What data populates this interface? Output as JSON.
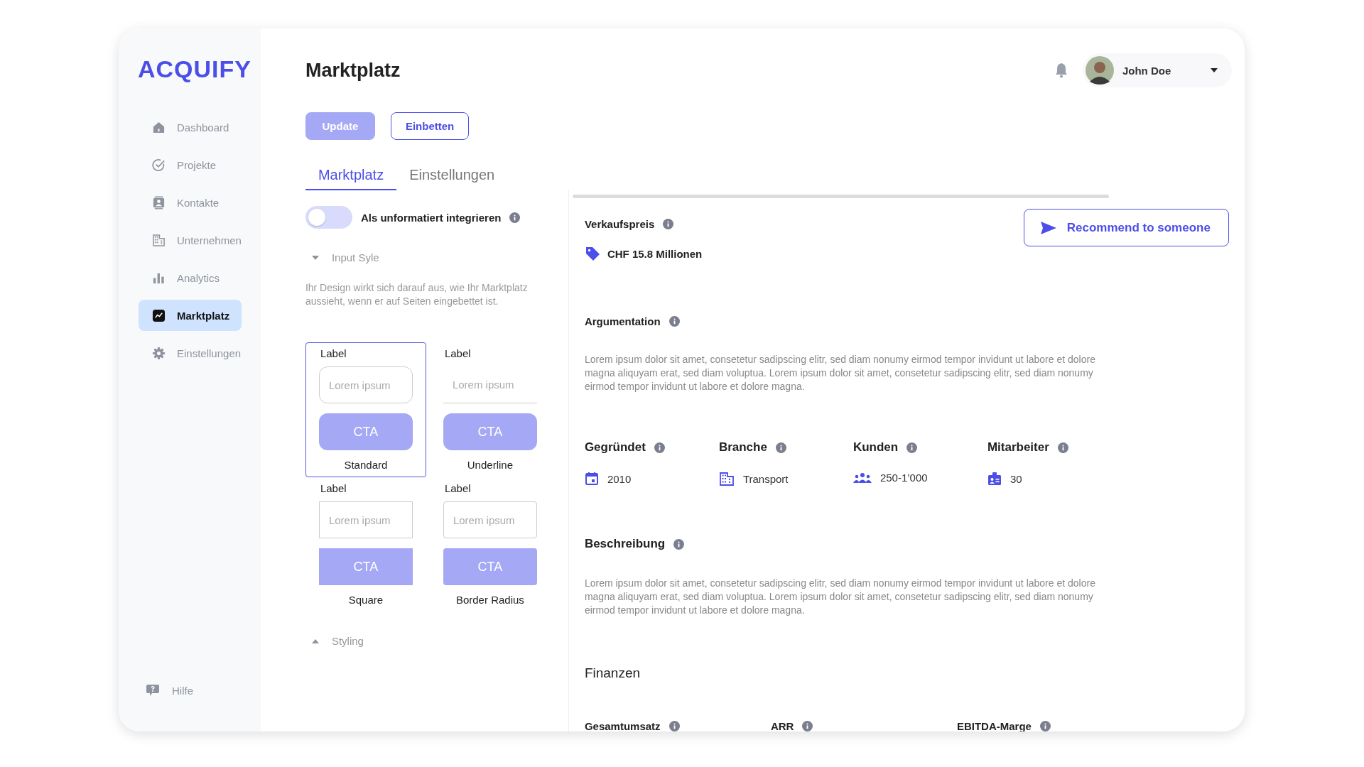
{
  "sidebar": {
    "logo": "ACQUIFY",
    "items": [
      {
        "label": "Dashboard",
        "selected": false
      },
      {
        "label": "Projekte",
        "selected": false
      },
      {
        "label": "Kontakte",
        "selected": false
      },
      {
        "label": "Unternehmen",
        "selected": false
      },
      {
        "label": "Analytics",
        "selected": false
      },
      {
        "label": "Marktplatz",
        "selected": true
      },
      {
        "label": "Einstellungen",
        "selected": false
      }
    ],
    "help": "Hilfe"
  },
  "header": {
    "title": "Marktplatz",
    "user": {
      "name": "John Doe"
    }
  },
  "actions": [
    {
      "label": "Update",
      "kind": "filled"
    },
    {
      "label": "Einbetten",
      "kind": "outline"
    }
  ],
  "tabs": [
    {
      "label": "Marktplatz",
      "selected": true
    },
    {
      "label": "Einstellungen",
      "selected": false
    }
  ],
  "embed_panel": {
    "toggle": {
      "label": "Als unformatiert integrieren",
      "on": false
    },
    "input_style": {
      "title": "Input Syle",
      "expanded": true,
      "description": "Ihr Design wirkt sich darauf aus, wie Ihr Marktplatz aussieht, wenn er auf Seiten eingebettet ist.",
      "variants": [
        {
          "kind": "standard",
          "name": "Standard",
          "label": "Label",
          "placeholder": "Lorem ipsum",
          "cta": "CTA",
          "selected": true
        },
        {
          "kind": "underline",
          "name": "Underline",
          "label": "Label",
          "placeholder": "Lorem ipsum",
          "cta": "CTA",
          "selected": false
        },
        {
          "kind": "square",
          "name": "Square",
          "label": "Label",
          "placeholder": "Lorem ipsum",
          "cta": "CTA",
          "selected": false
        },
        {
          "kind": "radius",
          "name": "Border Radius",
          "label": "Label",
          "placeholder": "Lorem ipsum",
          "cta": "CTA",
          "selected": false
        }
      ]
    },
    "styling": {
      "title": "Styling",
      "expanded": false
    }
  },
  "listing": {
    "price": {
      "label": "Verkaufspreis",
      "value": "CHF 15.8 Millionen"
    },
    "recommend_button": "Recommend to someone",
    "argumentation": {
      "title": "Argumentation",
      "text": "Lorem ipsum dolor sit amet, consetetur sadipscing elitr, sed diam nonumy eirmod tempor invidunt ut labore et dolore magna aliquyam erat, sed diam voluptua. Lorem ipsum dolor sit amet, consetetur sadipscing elitr, sed diam nonumy eirmod tempor invidunt ut labore et dolore magna."
    },
    "facts": [
      {
        "label": "Gegründet",
        "value": "2010"
      },
      {
        "label": "Branche",
        "value": "Transport"
      },
      {
        "label": "Kunden",
        "value": "250-1’000"
      },
      {
        "label": "Mitarbeiter",
        "value": "30"
      }
    ],
    "description": {
      "title": "Beschreibung",
      "text": "Lorem ipsum dolor sit amet, consetetur sadipscing elitr, sed diam nonumy eirmod tempor invidunt ut labore et dolore magna aliquyam erat, sed diam voluptua. Lorem ipsum dolor sit amet, consetetur sadipscing elitr, sed diam nonumy eirmod tempor invidunt ut labore et dolore magna."
    },
    "finances": {
      "title": "Finanzen",
      "metrics": [
        {
          "label": "Gesamtumsatz"
        },
        {
          "label": "ARR"
        },
        {
          "label": "EBITDA-Marge"
        }
      ]
    }
  }
}
